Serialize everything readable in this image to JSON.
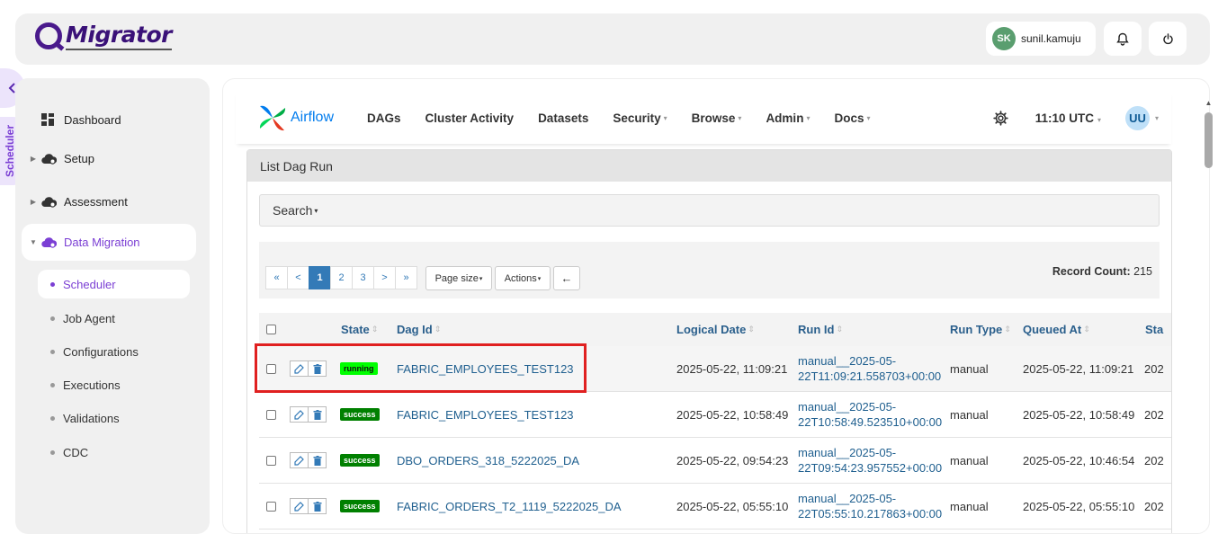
{
  "app": {
    "logo_text": "Migrator",
    "user": {
      "initials": "SK",
      "name": "sunil.kamuju"
    },
    "vertical_tab_label": "Scheduler"
  },
  "sidebar": {
    "items": [
      {
        "label": "Dashboard",
        "icon": "dashboard-icon"
      },
      {
        "label": "Setup",
        "icon": "cloud-gear-icon"
      },
      {
        "label": "Assessment",
        "icon": "cloud-gear-icon"
      },
      {
        "label": "Data Migration",
        "icon": "cloud-gear-icon"
      }
    ],
    "sub_items": [
      {
        "label": "Scheduler"
      },
      {
        "label": "Job Agent"
      },
      {
        "label": "Configurations"
      },
      {
        "label": "Executions"
      },
      {
        "label": "Validations"
      },
      {
        "label": "CDC"
      }
    ]
  },
  "airflow": {
    "brand": "Airflow",
    "menu": [
      {
        "label": "DAGs",
        "dropdown": false
      },
      {
        "label": "Cluster Activity",
        "dropdown": false
      },
      {
        "label": "Datasets",
        "dropdown": false
      },
      {
        "label": "Security",
        "dropdown": true
      },
      {
        "label": "Browse",
        "dropdown": true
      },
      {
        "label": "Admin",
        "dropdown": true
      },
      {
        "label": "Docs",
        "dropdown": true
      }
    ],
    "time": "11:10 UTC",
    "user_initials": "UU"
  },
  "panel": {
    "title": "List Dag Run",
    "search_label": "Search",
    "pager": [
      "«",
      "<",
      "1",
      "2",
      "3",
      ">",
      "»"
    ],
    "page_size_label": "Page size",
    "actions_label": "Actions",
    "back_arrow": "←",
    "record_count_label": "Record Count:",
    "record_count": "215"
  },
  "table": {
    "columns": [
      "State",
      "Dag Id",
      "Logical Date",
      "Run Id",
      "Run Type",
      "Queued At",
      "Sta"
    ],
    "rows": [
      {
        "state": "running",
        "dag_id": "FABRIC_EMPLOYEES_TEST123",
        "logical_date": "2025-05-22, 11:09:21",
        "run_id_1": "manual__2025-05-",
        "run_id_2": "22T11:09:21.558703+00:00",
        "run_type": "manual",
        "queued_at": "2025-05-22, 11:09:21",
        "start": "202"
      },
      {
        "state": "success",
        "dag_id": "FABRIC_EMPLOYEES_TEST123",
        "logical_date": "2025-05-22, 10:58:49",
        "run_id_1": "manual__2025-05-",
        "run_id_2": "22T10:58:49.523510+00:00",
        "run_type": "manual",
        "queued_at": "2025-05-22, 10:58:49",
        "start": "202"
      },
      {
        "state": "success",
        "dag_id": "DBO_ORDERS_318_5222025_DA",
        "logical_date": "2025-05-22, 09:54:23",
        "run_id_1": "manual__2025-05-",
        "run_id_2": "22T09:54:23.957552+00:00",
        "run_type": "manual",
        "queued_at": "2025-05-22, 10:46:54",
        "start": "202"
      },
      {
        "state": "success",
        "dag_id": "FABRIC_ORDERS_T2_1119_5222025_DA",
        "logical_date": "2025-05-22, 05:55:10",
        "run_id_1": "manual__2025-05-",
        "run_id_2": "22T05:55:10.217863+00:00",
        "run_type": "manual",
        "queued_at": "2025-05-22, 05:55:10",
        "start": "202"
      }
    ]
  },
  "colors": {
    "brand_purple": "#7b3fd4",
    "running_badge": "#00ff00",
    "success_badge": "#008000",
    "highlight_box": "#e02020",
    "link_blue": "#1f5f8f"
  }
}
